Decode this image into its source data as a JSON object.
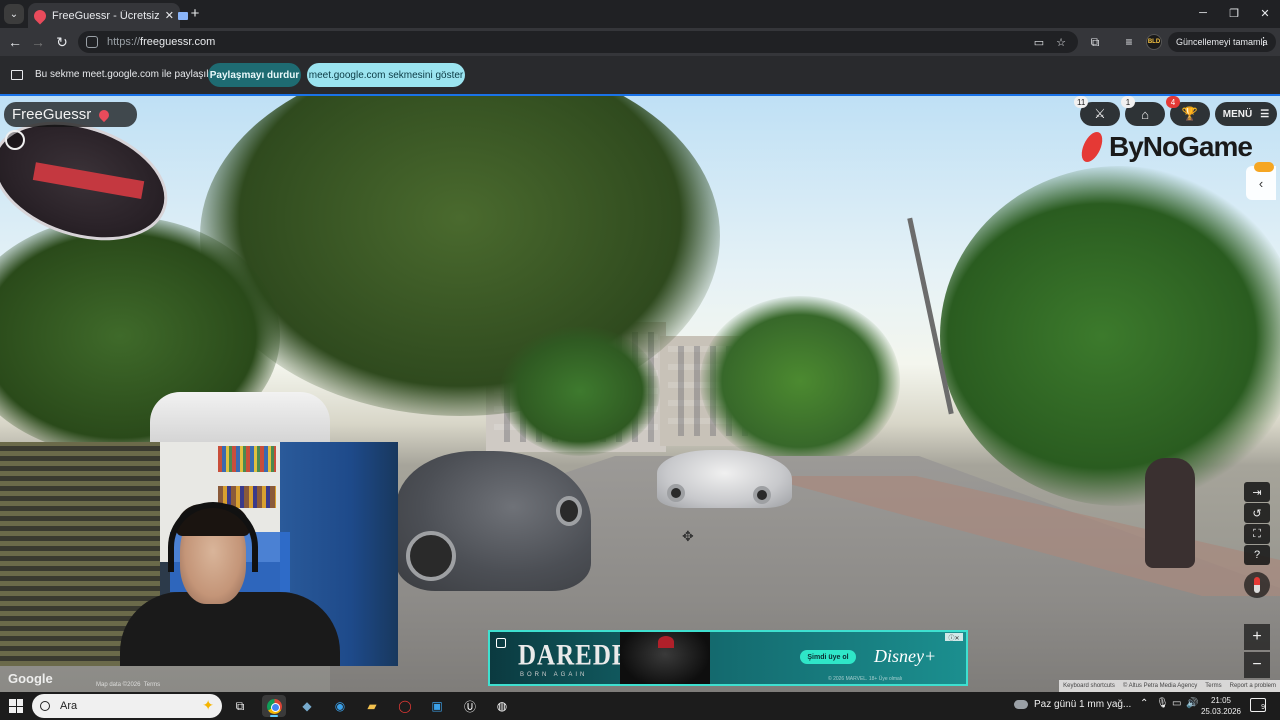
{
  "browser": {
    "tab_title": "FreeGuessr - Ücretsiz GeoG",
    "tab_close": "✕",
    "new_tab": "+",
    "url_scheme": "https://",
    "url_host": "freeguessr.com",
    "update_button": "Güncellemeyi tamamla",
    "profile_label": "BLD"
  },
  "sharebar": {
    "message": "Bu sekme meet.google.com ile paylaşılıyor",
    "stop_button": "Paylaşmayı durdur",
    "show_button": "meet.google.com sekmesini göster"
  },
  "game": {
    "logo": "FreeGuessr",
    "badges": {
      "battle": "11",
      "shop": "1",
      "trophy": "4"
    },
    "menu_label": "MENÜ",
    "sponsor": "ByNoGame",
    "attribution": {
      "shortcuts": "Keyboard shortcuts",
      "copyright": "© Altus Petra Media Agency",
      "terms": "Terms",
      "report": "Report a problem"
    },
    "google_watermark": "Google",
    "map_data": "Map data ©2026",
    "terms_small": "Terms"
  },
  "ad": {
    "title": "DAREDEVIL",
    "subtitle": "BORN AGAIN",
    "cta": "Şimdi üye ol",
    "brand": "Disney+",
    "fine_print": "© 2026 MARVEL. 18+ Üye olmalı"
  },
  "taskbar": {
    "search_placeholder": "Ara",
    "weather": "Paz günü 1 mm yağ...",
    "time": "21:05",
    "date": "25.03.2026",
    "notifications": "9"
  },
  "colors": {
    "accent_blue": "#1a73e8",
    "stop_button": "#1e6b72",
    "show_button": "#9be4f0",
    "freeguessr_red": "#e94b5b",
    "ad_cyan": "#3ee0d0"
  }
}
